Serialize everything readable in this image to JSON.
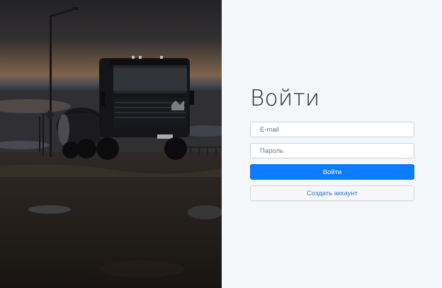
{
  "login": {
    "title": "Войти",
    "email_placeholder": "E-mail",
    "password_placeholder": "Пароль",
    "submit_label": "Войти",
    "register_label": "Создать аккаунт"
  },
  "colors": {
    "primary": "#0d7bff",
    "link": "#2a78d6",
    "panel_bg": "#f6f7f9"
  }
}
